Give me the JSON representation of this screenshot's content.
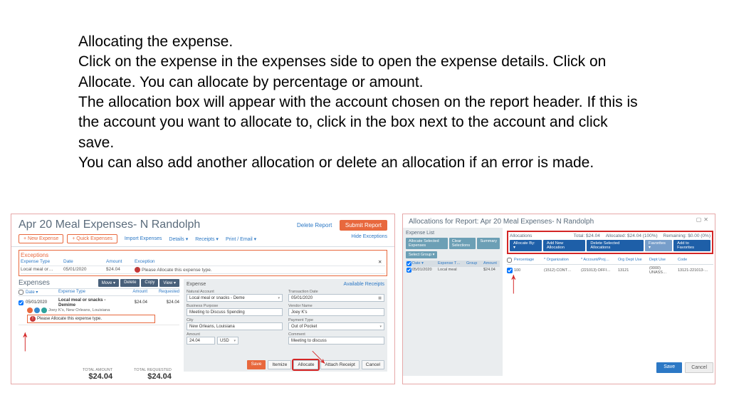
{
  "instructions": {
    "p1": "Allocating the expense.",
    "p2": "Click on the expense in the expenses side to open the expense details. Click on Allocate. You can allocate by percentage or amount.",
    "p3": "The allocation box will appear with the account chosen on the report header. If this is the account you want to allocate to, click in the box next to the account and click save.",
    "p4": "You can also add another allocation or delete an allocation if an error is made."
  },
  "left": {
    "title": "Apr 20 Meal Expenses- N Randolph",
    "deleteReport": "Delete Report",
    "submitReport": "Submit Report",
    "toolbar": {
      "newExpense": "+ New Expense",
      "quickExpenses": "+ Quick Expenses",
      "import": "Import Expenses",
      "details": "Details ▾",
      "receipts": "Receipts ▾",
      "print": "Print / Email ▾",
      "hideExceptions": "Hide Exceptions"
    },
    "exceptions": {
      "title": "Exceptions",
      "headers": {
        "type": "Expense Type",
        "date": "Date",
        "amount": "Amount",
        "exception": "Exception"
      },
      "row": {
        "type": "Local meal or…",
        "date": "05/01/2020",
        "amount": "$24.04",
        "msg": "Please Allocate this expense type."
      }
    },
    "expenses": {
      "title": "Expenses",
      "btns": {
        "move": "Move ▾",
        "delete": "Delete",
        "copy": "Copy",
        "view": "View ▾"
      },
      "headers": {
        "date": "Date ▾",
        "type": "Expense Type",
        "amount": "Amount",
        "requested": "Requested"
      },
      "row": {
        "date": "05/01/2020",
        "type": "Local meal or snacks - Demime",
        "amount": "$24.04",
        "requested": "$24.04",
        "sub": "Joey K's, New Orleans, Louisiana",
        "warn": "Please Allocate this expense type."
      }
    },
    "totals": {
      "totalLabel": "TOTAL AMOUNT",
      "total": "$24.04",
      "reqLabel": "TOTAL REQUESTED",
      "req": "$24.04"
    },
    "detail": {
      "tab": "Expense",
      "availReceipts": "Available Receipts",
      "fields": {
        "naturalAccount": {
          "label": "Natural Account",
          "value": "Local meal or snacks - Deme"
        },
        "transactionDate": {
          "label": "Transaction Date",
          "value": "05/01/2020"
        },
        "businessPurpose": {
          "label": "Business Purpose",
          "value": "Meeting to Discuss Spending"
        },
        "vendorName": {
          "label": "Vendor Name",
          "value": "Joey K's"
        },
        "city": {
          "label": "City",
          "value": "New Orleans, Louisiana"
        },
        "paymentType": {
          "label": "Payment Type",
          "value": "Out of Pocket"
        },
        "amount": {
          "label": "Amount",
          "value": "24.04",
          "currency": "USD"
        },
        "comment": {
          "label": "Comment",
          "value": "Meeting to discuss"
        }
      },
      "btns": {
        "save": "Save",
        "itemize": "Itemize",
        "allocate": "Allocate",
        "attach": "Attach Receipt",
        "cancel": "Cancel"
      }
    }
  },
  "right": {
    "title": "Allocations for Report: Apr 20 Meal Expenses- N Randolph",
    "expenseList": {
      "title": "Expense List",
      "btns": {
        "allocSel": "Allocate Selected Expenses",
        "clearSel": "Clear Selections",
        "summary": "Summary"
      },
      "selectGroup": "Select Group ▾",
      "headers": {
        "date": "Date ▾",
        "type": "Expense T…",
        "group": "Group",
        "amount": "Amount"
      },
      "row": {
        "date": "05/01/2020",
        "type": "Local meal",
        "group": "",
        "amount": "$24.04"
      }
    },
    "allocations": {
      "title": "Allocations",
      "total": "Total: $24.04",
      "allocated": "Allocated: $24.04 (100%)",
      "remaining": "Remaining: $0.00 (0%)",
      "btns": {
        "allocBy": "Allocate By: ▾",
        "addNew": "Add New Allocation",
        "deleteSel": "Delete Selected Allocations",
        "favorites": "Favorites ▾",
        "addFav": "Add to Favorites"
      },
      "headers": {
        "pct": "Percentage",
        "org": "* Organization",
        "acct": "* Account/Proj…",
        "orgDept": "Org Dept Use",
        "dept": "Dept Use",
        "code": "Code"
      },
      "row": {
        "pct": "100",
        "org": "(1512) CONT…",
        "acct": "(221013) OFFI…",
        "orgDept": "13121",
        "dept": "(0000) UNASS…",
        "code": "13121-221013-…"
      }
    },
    "bottom": {
      "save": "Save",
      "cancel": "Cancel"
    }
  }
}
